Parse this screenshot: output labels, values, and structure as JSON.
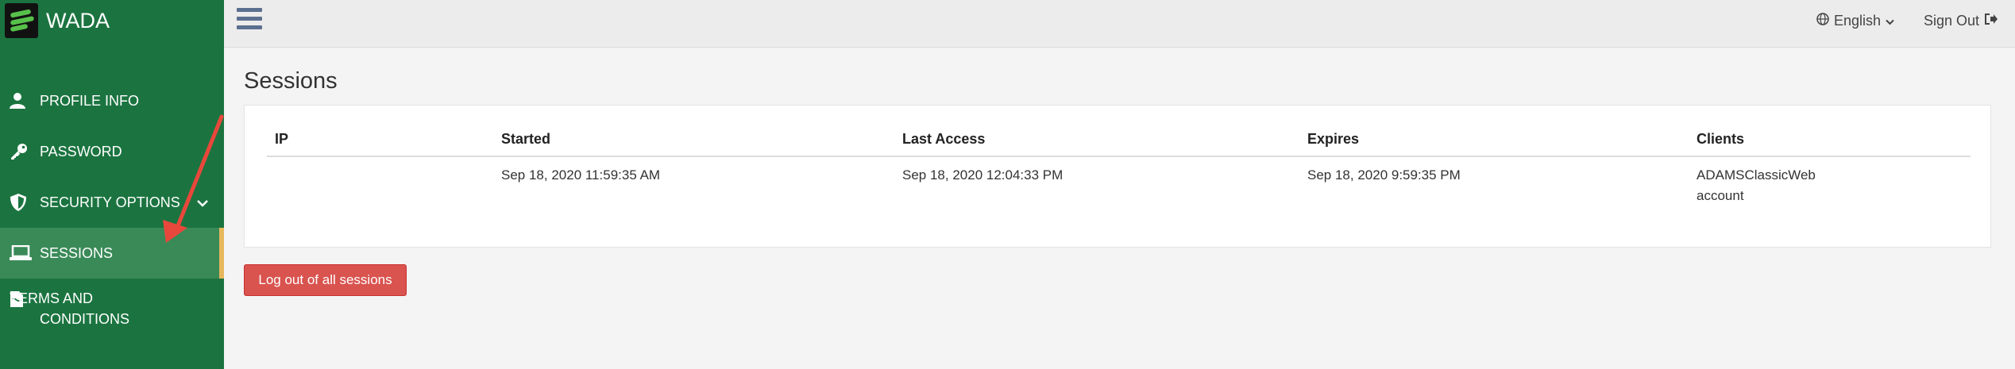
{
  "app": {
    "name": "WADA"
  },
  "sidebar": {
    "items": [
      {
        "label": "PROFILE INFO",
        "icon": "user-icon"
      },
      {
        "label": "PASSWORD",
        "icon": "key-icon"
      },
      {
        "label": "SECURITY OPTIONS",
        "icon": "shield-icon"
      },
      {
        "label": "SESSIONS",
        "icon": "laptop-icon",
        "active": true
      },
      {
        "label": "TERMS AND CONDITIONS",
        "icon": "document-icon"
      }
    ]
  },
  "header": {
    "language": "English",
    "sign_out": "Sign Out"
  },
  "main": {
    "title": "Sessions",
    "table": {
      "columns": [
        "IP",
        "Started",
        "Last Access",
        "Expires",
        "Clients"
      ],
      "rows": [
        {
          "ip": "",
          "started": "Sep 18, 2020 11:59:35 AM",
          "last_access": "Sep 18, 2020 12:04:33 PM",
          "expires": "Sep 18, 2020 9:59:35 PM",
          "clients": [
            "ADAMSClassicWeb",
            "account"
          ]
        }
      ]
    },
    "logout_all_label": "Log out of all sessions"
  },
  "colors": {
    "sidebar": "#1b7440",
    "active_item": "#3a8a58",
    "active_marker": "#e7b75c",
    "danger": "#d9534f",
    "annotation_arrow": "#e8473b"
  }
}
